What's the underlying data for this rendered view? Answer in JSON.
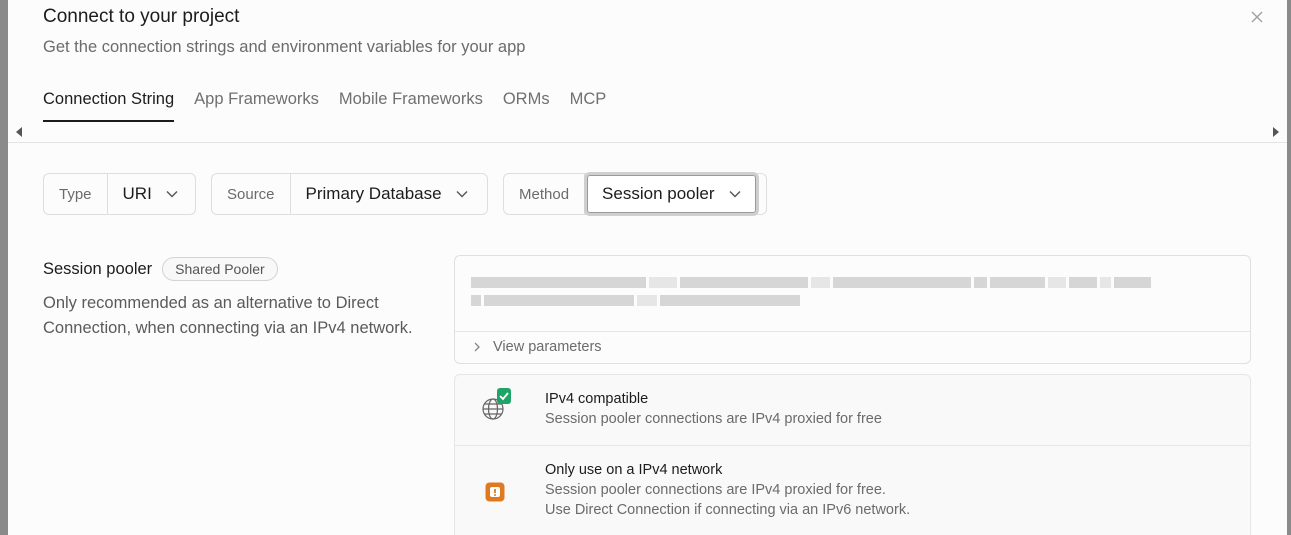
{
  "dialog": {
    "title": "Connect to your project",
    "subtitle": "Get the connection strings and environment variables for your app",
    "close_icon": "close-icon"
  },
  "tabs": [
    {
      "label": "Connection String",
      "active": true
    },
    {
      "label": "App Frameworks",
      "active": false
    },
    {
      "label": "Mobile Frameworks",
      "active": false
    },
    {
      "label": "ORMs",
      "active": false
    },
    {
      "label": "MCP",
      "active": false
    }
  ],
  "selectors": {
    "type": {
      "label": "Type",
      "value": "URI"
    },
    "source": {
      "label": "Source",
      "value": "Primary Database"
    },
    "method": {
      "label": "Method",
      "value": "Session pooler"
    }
  },
  "section": {
    "title": "Session pooler",
    "badge": "Shared Pooler",
    "description": "Only recommended as an alternative to Direct Connection, when connecting via an IPv4 network."
  },
  "connection": {
    "view_parameters": "View parameters",
    "string_redacted": true
  },
  "notes": [
    {
      "icon": "globe-check-icon",
      "title": "IPv4 compatible",
      "lines": [
        "Session pooler connections are IPv4 proxied for free"
      ]
    },
    {
      "icon": "warning-icon",
      "title": "Only use on a IPv4 network",
      "lines": [
        "Session pooler connections are IPv4 proxied for free.",
        "Use Direct Connection if connecting via an IPv6 network."
      ]
    }
  ],
  "colors": {
    "check_green": "#1fa366",
    "warning_orange": "#e07a1f"
  }
}
